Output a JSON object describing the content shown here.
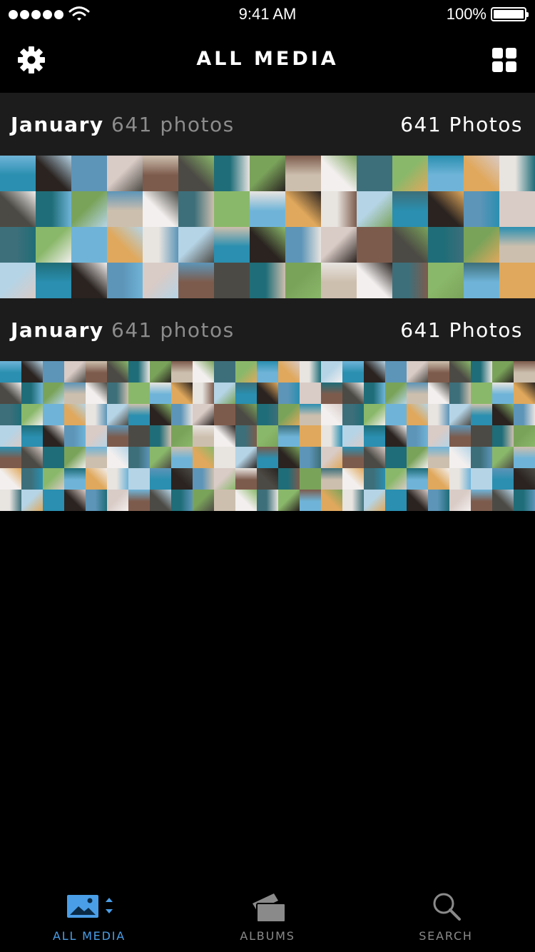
{
  "status_bar": {
    "time": "9:41 AM",
    "battery_percent": "100%",
    "signal_icon": "signal-dots-icon",
    "wifi_icon": "wifi-icon",
    "battery_icon": "battery-icon"
  },
  "nav": {
    "title": "ALL MEDIA",
    "settings_icon": "gear-icon",
    "view_icon": "grid-view-icon"
  },
  "sections": [
    {
      "month": "January",
      "count_text": "641 photos",
      "right_text": "641 Photos",
      "grid_size": "large"
    },
    {
      "month": "January",
      "count_text": "641 photos",
      "right_text": "641 Photos",
      "grid_size": "small"
    }
  ],
  "tabs": [
    {
      "label": "ALL MEDIA",
      "icon": "photo-icon",
      "active": true
    },
    {
      "label": "ALBUMS",
      "icon": "albums-icon",
      "active": false
    },
    {
      "label": "SEARCH",
      "icon": "search-icon",
      "active": false
    }
  ],
  "colors": {
    "accent": "#4a9ee8",
    "background": "#000000",
    "section_header_bg": "#1c1c1c",
    "inactive_tab": "#8a8a8a",
    "photo_palette": [
      "#2a8fb0",
      "#7aa35a",
      "#e8e4e0",
      "#4c4a44",
      "#6fb4d8",
      "#d9cbc6",
      "#3d6f7a",
      "#2a2320",
      "#cdbfae",
      "#b5d4e6",
      "#1f6d78",
      "#e0a85c",
      "#7d5b4c",
      "#8ab86a",
      "#5d95b8",
      "#f2efee"
    ]
  }
}
